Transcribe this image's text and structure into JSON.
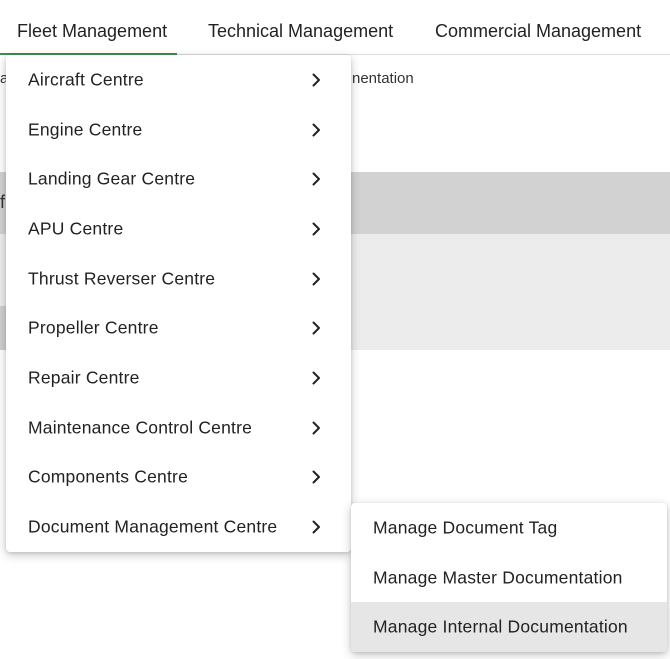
{
  "nav": {
    "tabs": [
      {
        "label": "Fleet Management"
      },
      {
        "label": "Technical Management"
      },
      {
        "label": "Commercial Management"
      }
    ],
    "active_color": "#3f8f4e"
  },
  "background": {
    "breadcrumb_left": "a",
    "breadcrumb_right": "nentation",
    "band_text": "f"
  },
  "menu": {
    "items": [
      {
        "label": "Aircraft Centre"
      },
      {
        "label": "Engine Centre"
      },
      {
        "label": "Landing Gear Centre"
      },
      {
        "label": "APU Centre"
      },
      {
        "label": "Thrust Reverser Centre"
      },
      {
        "label": "Propeller Centre"
      },
      {
        "label": "Repair Centre"
      },
      {
        "label": "Maintenance Control Centre"
      },
      {
        "label": "Components Centre"
      },
      {
        "label": "Document Management Centre"
      }
    ],
    "chevron_icon": "chevron-right-icon"
  },
  "submenu": {
    "items": [
      {
        "label": "Manage Document Tag"
      },
      {
        "label": "Manage Master Documentation"
      },
      {
        "label": "Manage Internal Documentation"
      }
    ],
    "highlight_color": "#e6e6e6"
  }
}
